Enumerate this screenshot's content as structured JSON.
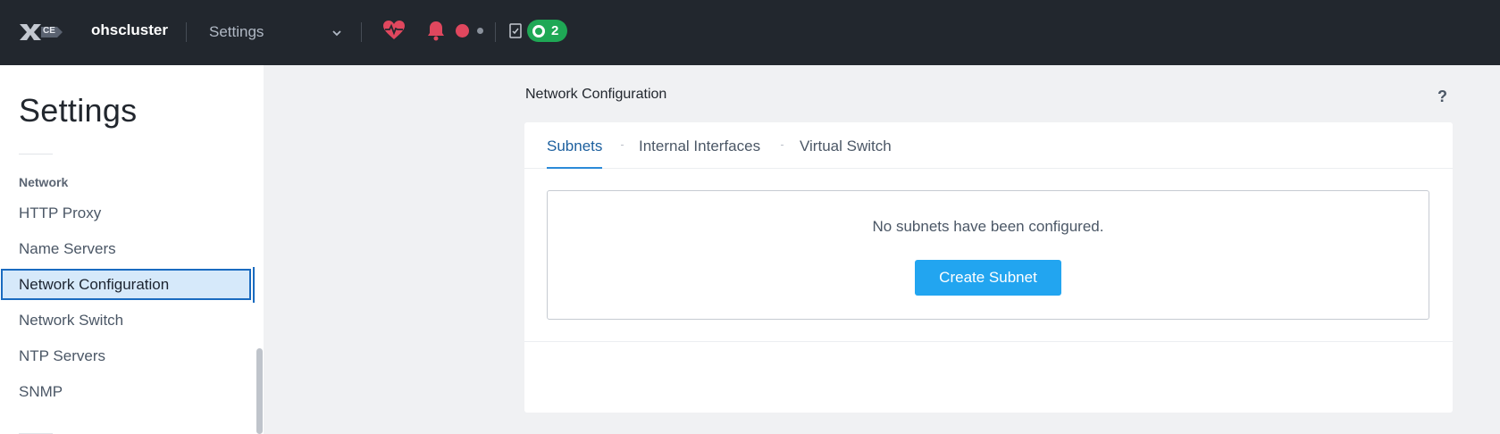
{
  "topbar": {
    "logo_badge": "CE",
    "cluster_name": "ohscluster",
    "section_selected": "Settings",
    "tasks_count": "2"
  },
  "sidebar": {
    "title": "Settings",
    "group_label": "Network",
    "items": [
      {
        "label": "HTTP Proxy",
        "active": false
      },
      {
        "label": "Name Servers",
        "active": false
      },
      {
        "label": "Network Configuration",
        "active": true
      },
      {
        "label": "Network Switch",
        "active": false
      },
      {
        "label": "NTP Servers",
        "active": false
      },
      {
        "label": "SNMP",
        "active": false
      }
    ]
  },
  "main": {
    "heading": "Network Configuration",
    "help_label": "?",
    "tabs": [
      {
        "label": "Subnets",
        "active": true
      },
      {
        "label": "Internal Interfaces",
        "active": false
      },
      {
        "label": "Virtual Switch",
        "active": false
      }
    ],
    "empty_message": "No subnets have been configured.",
    "create_button_label": "Create Subnet"
  },
  "colors": {
    "topbar_bg": "#22272e",
    "accent_blue": "#22a5f0",
    "active_border": "#1a6bc0",
    "health_red": "#e0475e",
    "tasks_green": "#1fa855"
  },
  "icons": {
    "logo": "x-logo-icon",
    "dropdown": "chevron-down-icon",
    "health": "heartbeat-icon",
    "alerts": "bell-icon",
    "tasks": "clipboard-check-icon",
    "help": "question-mark-icon"
  }
}
